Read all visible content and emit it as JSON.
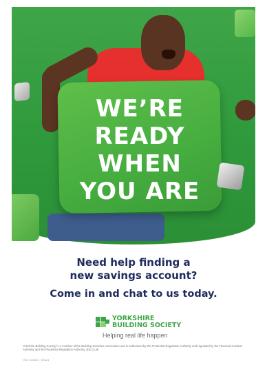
{
  "headline": {
    "line1": "WE’RE",
    "line2": "READY",
    "line3": "WHEN",
    "line4": "YOU ARE"
  },
  "subheading": {
    "line1": "Need help finding a",
    "line2": "new savings account?",
    "line3": "Come in and chat to us today."
  },
  "brand": {
    "name_line1": "YORKSHIRE",
    "name_line2": "BUILDING SOCIETY",
    "tagline": "Helping real life happen"
  },
  "legal_text": "Yorkshire Building Society is a member of the Building Societies Association and is authorised by the Prudential Regulation Authority and regulated by the Financial Conduct Authority and the Prudential Regulation Authority. ybs.co.uk",
  "reference": "YBS 10/2024 · 8/1/24",
  "colors": {
    "brand_green": "#3fa548",
    "navy_text": "#1f2b5b"
  }
}
